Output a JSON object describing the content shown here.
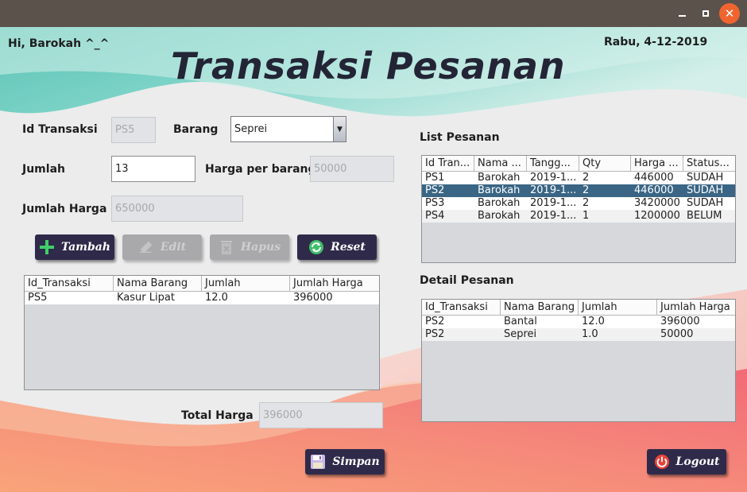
{
  "window": {
    "minimize_icon": "minimize-icon",
    "maximize_icon": "maximize-icon",
    "close_icon": "close-icon",
    "close_glyph": "✕"
  },
  "header": {
    "greeting": "Hi, Barokah ^_^",
    "date": "Rabu, 4-12-2019",
    "title": "Transaksi Pesanan"
  },
  "form": {
    "id_transaksi_label": "Id Transaksi",
    "id_transaksi_value": "PS5",
    "barang_label": "Barang",
    "barang_value": "Seprei",
    "jumlah_label": "Jumlah",
    "jumlah_value": "13",
    "harga_per_barang_label": "Harga per barang",
    "harga_per_barang_value": "50000",
    "jumlah_harga_label": "Jumlah Harga",
    "jumlah_harga_value": "650000"
  },
  "buttons": {
    "tambah": "Tambah",
    "edit": "Edit",
    "hapus": "Hapus",
    "reset": "Reset",
    "simpan": "Simpan",
    "logout": "Logout"
  },
  "cart_table": {
    "columns": [
      "Id_Transaksi",
      "Nama Barang",
      "Jumlah",
      "Jumlah Harga"
    ],
    "rows": [
      [
        "PS5",
        "Kasur Lipat",
        "12.0",
        "396000"
      ]
    ]
  },
  "total": {
    "label": "Total Harga",
    "value": "396000"
  },
  "list_pesanan": {
    "label": "List Pesanan",
    "columns": [
      "Id Tran...",
      "Nama ...",
      "Tangg...",
      "Qty",
      "Harga ...",
      "Status..."
    ],
    "rows": [
      [
        "PS1",
        "Barokah",
        "2019-1...",
        "2",
        "446000",
        "SUDAH"
      ],
      [
        "PS2",
        "Barokah",
        "2019-1...",
        "2",
        "446000",
        "SUDAH"
      ],
      [
        "PS3",
        "Barokah",
        "2019-1...",
        "2",
        "3420000",
        "SUDAH"
      ],
      [
        "PS4",
        "Barokah",
        "2019-1...",
        "1",
        "1200000",
        "BELUM"
      ]
    ],
    "selected_row": 1
  },
  "detail_pesanan": {
    "label": "Detail Pesanan",
    "columns": [
      "Id_Transaksi",
      "Nama Barang",
      "Jumlah",
      "Jumlah Harga"
    ],
    "rows": [
      [
        "PS2",
        "Bantal",
        "12.0",
        "396000"
      ],
      [
        "PS2",
        "Seprei",
        "1.0",
        "50000"
      ]
    ]
  },
  "colors": {
    "button_dark": "#2f2a4a",
    "selected_row": "#3a6584",
    "teal_wave": "#7fd3c8",
    "coral_wave": "#f47d7a"
  }
}
